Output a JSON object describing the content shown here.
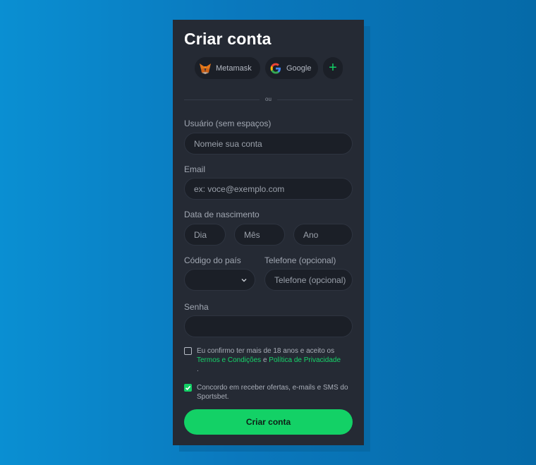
{
  "form": {
    "title": "Criar conta",
    "social": {
      "metamask_label": "Metamask",
      "google_label": "Google",
      "more_label": "+"
    },
    "divider_text": "ou",
    "username": {
      "label": "Usuário (sem espaços)",
      "placeholder": "Nomeie sua conta",
      "value": ""
    },
    "email": {
      "label": "Email",
      "placeholder": "ex: voce@exemplo.com",
      "value": ""
    },
    "birthdate": {
      "label": "Data de nascimento",
      "day_placeholder": "Dia",
      "month_placeholder": "Mês",
      "year_placeholder": "Ano"
    },
    "country_code": {
      "label": "Código do país",
      "value": ""
    },
    "phone": {
      "label": "Telefone (opcional)",
      "placeholder": "Telefone (opcional)"
    },
    "password": {
      "label": "Senha",
      "value": ""
    },
    "age_consent": {
      "checked": false,
      "text_before": "Eu confirmo ter mais de 18 anos e aceito os",
      "terms_link": "Termos e Condições",
      "conjunction": "e",
      "privacy_link": "Política de Privacidade",
      "text_after": "."
    },
    "marketing_consent": {
      "checked": true,
      "text": "Concordo em receber ofertas, e-mails e SMS do Sportsbet."
    },
    "submit_label": "Criar conta"
  },
  "colors": {
    "accent": "#13d166",
    "card_bg": "#252a34",
    "input_bg": "#1b1f27",
    "background": "#0a80c4"
  }
}
